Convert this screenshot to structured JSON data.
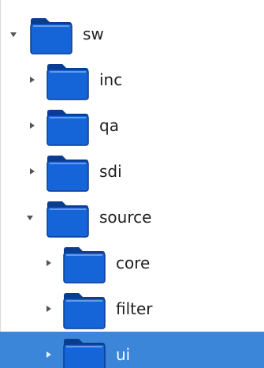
{
  "tree": {
    "items": [
      {
        "label": "sw",
        "depth": 0,
        "expanded": true,
        "selected": false,
        "icon": "folder-icon"
      },
      {
        "label": "inc",
        "depth": 1,
        "expanded": false,
        "selected": false,
        "icon": "folder-icon"
      },
      {
        "label": "qa",
        "depth": 1,
        "expanded": false,
        "selected": false,
        "icon": "folder-icon"
      },
      {
        "label": "sdi",
        "depth": 1,
        "expanded": false,
        "selected": false,
        "icon": "folder-icon"
      },
      {
        "label": "source",
        "depth": 1,
        "expanded": true,
        "selected": false,
        "icon": "folder-icon"
      },
      {
        "label": "core",
        "depth": 2,
        "expanded": false,
        "selected": false,
        "icon": "folder-icon"
      },
      {
        "label": "filter",
        "depth": 2,
        "expanded": false,
        "selected": false,
        "icon": "folder-icon"
      },
      {
        "label": "ui",
        "depth": 2,
        "expanded": false,
        "selected": true,
        "icon": "folder-icon"
      }
    ]
  },
  "colors": {
    "selection": "#3b86d8",
    "folder_blue": "#1565d8",
    "folder_dark": "#0a3d91"
  }
}
